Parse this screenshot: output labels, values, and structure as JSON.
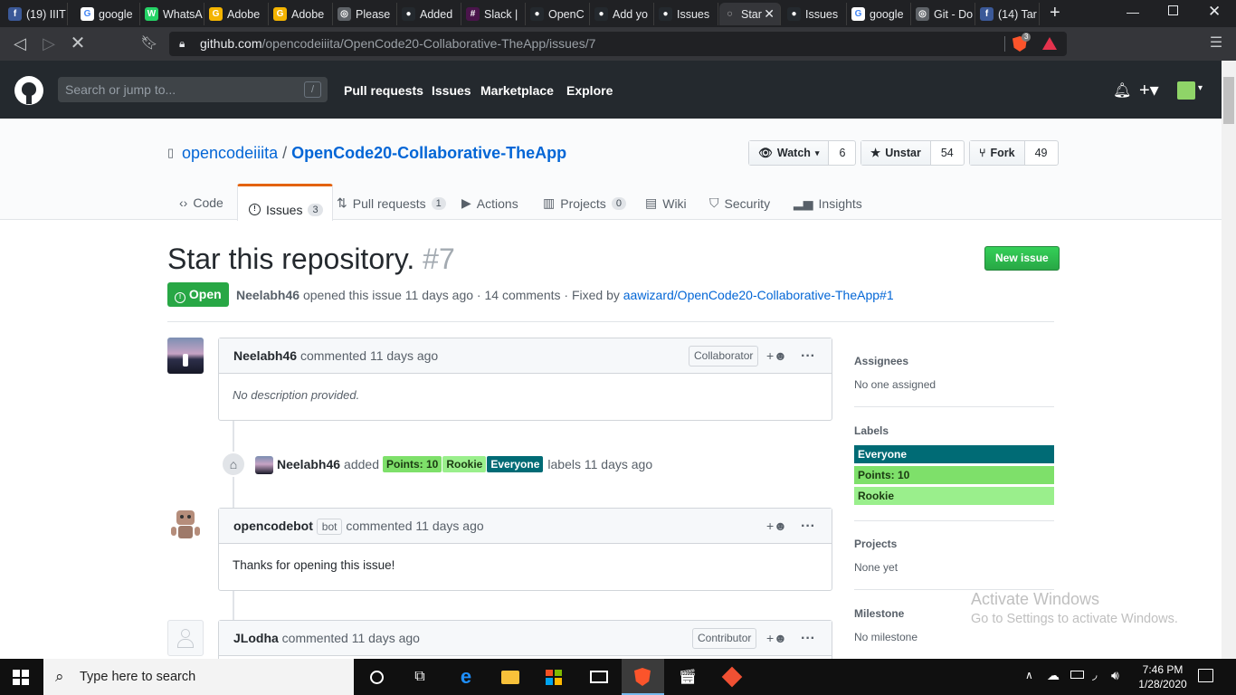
{
  "browser": {
    "tabs": [
      {
        "label": "(19) IIIT",
        "icon": "facebook-icon",
        "color": "#3b5998",
        "glyph": "f"
      },
      {
        "label": "google",
        "icon": "google-icon",
        "color": "#ffffff",
        "glyph": "G"
      },
      {
        "label": "WhatsA",
        "icon": "whatsapp-icon",
        "color": "#25d366",
        "glyph": "W"
      },
      {
        "label": "Adobe",
        "icon": "google-drive-icon",
        "color": "#f4b400",
        "glyph": "G"
      },
      {
        "label": "Adobe",
        "icon": "google-drive-icon",
        "color": "#f4b400",
        "glyph": "G"
      },
      {
        "label": "Please",
        "icon": "globe-icon",
        "color": "#5f6368",
        "glyph": "◎"
      },
      {
        "label": "Added",
        "icon": "github-icon",
        "color": "#24292e",
        "glyph": "●"
      },
      {
        "label": "Slack | ",
        "icon": "slack-icon",
        "color": "#4a154b",
        "glyph": "#"
      },
      {
        "label": "OpenC",
        "icon": "github-icon",
        "color": "#24292e",
        "glyph": "●"
      },
      {
        "label": "Add yo",
        "icon": "github-icon",
        "color": "#24292e",
        "glyph": "●"
      },
      {
        "label": "Issues",
        "icon": "github-icon",
        "color": "#24292e",
        "glyph": "●"
      },
      {
        "label": "Star",
        "icon": "loading-icon",
        "color": "#35363a",
        "glyph": "◌"
      },
      {
        "label": "Issues",
        "icon": "github-icon",
        "color": "#24292e",
        "glyph": "●"
      },
      {
        "label": "google",
        "icon": "google-icon",
        "color": "#ffffff",
        "glyph": "G"
      },
      {
        "label": "Git - Do",
        "icon": "globe-icon",
        "color": "#5f6368",
        "glyph": "◎"
      },
      {
        "label": "(14) Tar",
        "icon": "facebook-icon",
        "color": "#3b5998",
        "glyph": "f"
      }
    ],
    "url_host": "github.com",
    "url_path": "/opencodeiiita/OpenCode20-Collaborative-TheApp/issues/7",
    "brave_badge": "3"
  },
  "gh": {
    "search_placeholder": "Search or jump to...",
    "search_key": "/",
    "nav": [
      "Pull requests",
      "Issues",
      "Marketplace",
      "Explore"
    ]
  },
  "repo": {
    "owner": "opencodeiiita",
    "sep": "/",
    "name": "OpenCode20-Collaborative-TheApp",
    "watch_label": "Watch",
    "watch_count": "6",
    "star_label": "Unstar",
    "star_count": "54",
    "fork_label": "Fork",
    "fork_count": "49",
    "tabs": {
      "code": "Code",
      "issues": "Issues",
      "issues_count": "3",
      "pulls": "Pull requests",
      "pulls_count": "1",
      "actions": "Actions",
      "projects": "Projects",
      "projects_count": "0",
      "wiki": "Wiki",
      "security": "Security",
      "insights": "Insights"
    }
  },
  "issue": {
    "title": "Star this repository.",
    "number": "#7",
    "new_issue": "New issue",
    "state": "Open",
    "author": "Neelabh46",
    "meta": "opened this issue 11 days ago · 14 comments · Fixed by",
    "fixed_by": "aawizard/OpenCode20-Collaborative-TheApp#1"
  },
  "comments": {
    "c1": {
      "author": "Neelabh46",
      "action": "commented 11 days ago",
      "role": "Collaborator",
      "body": "No description provided."
    },
    "event": {
      "author": "Neelabh46",
      "action": "added",
      "suffix": "labels 11 days ago"
    },
    "c2": {
      "author": "opencodebot",
      "bot": "bot",
      "action": "commented 11 days ago",
      "body": "Thanks for opening this issue!"
    },
    "c3": {
      "author": "JLodha",
      "action": "commented 11 days ago",
      "role": "Contributor"
    }
  },
  "labels": [
    {
      "name": "Points: 10",
      "color": "#7ee06a",
      "text": "#1b3a12"
    },
    {
      "name": "Rookie",
      "color": "#9aef8c",
      "text": "#1b3a12"
    },
    {
      "name": "Everyone",
      "color": "#006b75",
      "text": "#ffffff"
    }
  ],
  "sidebar": {
    "assignees_h": "Assignees",
    "assignees_v": "No one assigned",
    "labels_h": "Labels",
    "labels": [
      {
        "name": "Everyone",
        "color": "#006b75",
        "text": "#ffffff"
      },
      {
        "name": "Points: 10",
        "color": "#7ee06a",
        "text": "#1b3a12"
      },
      {
        "name": "Rookie",
        "color": "#9aef8c",
        "text": "#1b3a12"
      }
    ],
    "projects_h": "Projects",
    "projects_v": "None yet",
    "milestone_h": "Milestone",
    "milestone_v": "No milestone"
  },
  "watermark": {
    "title": "Activate Windows",
    "sub": "Go to Settings to activate Windows."
  },
  "taskbar": {
    "search_placeholder": "Type here to search",
    "time": "7:46 PM",
    "date": "1/28/2020"
  }
}
